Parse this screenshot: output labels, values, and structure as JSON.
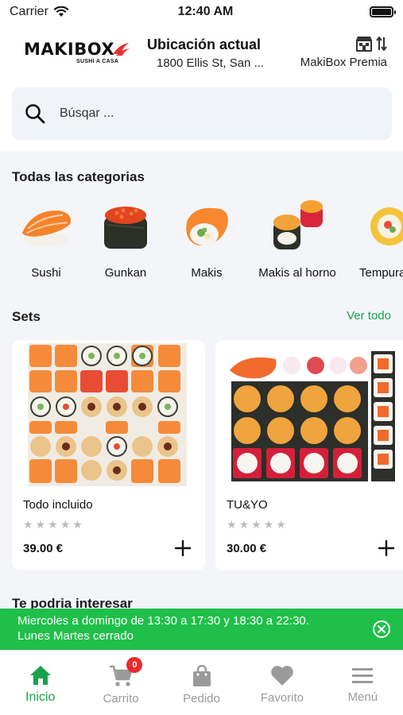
{
  "status_bar": {
    "carrier": "Carrier",
    "time": "12:40 AM"
  },
  "header": {
    "logo_text": "MAKIBOX",
    "logo_subtext": "SUSHI A CASA",
    "location_title": "Ubicación actual",
    "location_address": "1800 Ellis St, San ...",
    "premia_label": "MakiBox Premia"
  },
  "search": {
    "placeholder": "Búsqar ..."
  },
  "categories": {
    "title": "Todas las categorias",
    "items": [
      {
        "label": "Sushi",
        "icon": "sushi-nigiri-icon"
      },
      {
        "label": "Gunkan",
        "icon": "gunkan-icon"
      },
      {
        "label": "Makis",
        "icon": "maki-roll-icon"
      },
      {
        "label": "Makis al horno",
        "icon": "baked-maki-icon"
      },
      {
        "label": "Tempura",
        "icon": "tempura-icon"
      }
    ]
  },
  "sets": {
    "title": "Sets",
    "see_all": "Ver todo",
    "items": [
      {
        "name": "Todo incluido",
        "rating": 0,
        "price": "39.00 €"
      },
      {
        "name": "TU&YO",
        "rating": 0,
        "price": "30.00 €"
      }
    ]
  },
  "interest_title": "Te podria interesar",
  "banner": {
    "line1": "Miercoles a domingo de 13:30 a 17:30 y 18:30 a 22:30.",
    "line2": "Lunes Martes cerrado"
  },
  "tabbar": {
    "items": [
      {
        "label": "Inicio",
        "icon": "home-icon",
        "active": true
      },
      {
        "label": "Carrito",
        "icon": "cart-icon",
        "badge": "0"
      },
      {
        "label": "Pedido",
        "icon": "bag-icon"
      },
      {
        "label": "Favorito",
        "icon": "heart-icon"
      },
      {
        "label": "Menú",
        "icon": "menu-icon"
      }
    ]
  },
  "colors": {
    "accent": "#17a34a",
    "banner": "#1fbf49",
    "badge": "#ea2b2b",
    "background": "#f3f5f9"
  }
}
